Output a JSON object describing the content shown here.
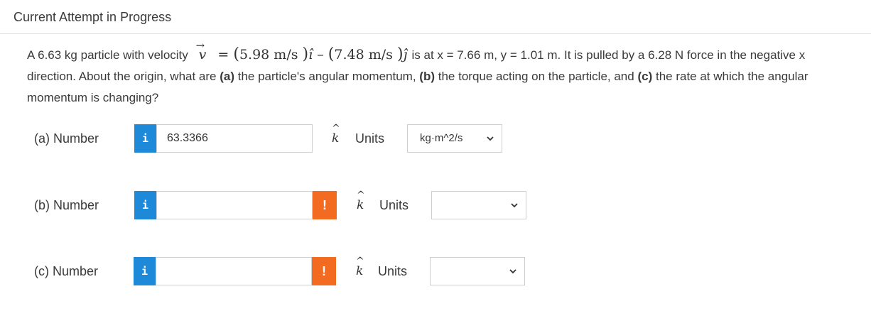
{
  "header": {
    "title": "Current Attempt in Progress"
  },
  "question": {
    "intro": "A 6.63 kg particle with velocity",
    "vector_symbol": "v",
    "equals": "=",
    "vx_value": "5.98 m/s",
    "i_hat": "î",
    "minus": "–",
    "vy_value": "7.48 m/s",
    "j_hat": "ĵ",
    "middle": "is at x = 7.66 m, y = 1.01 m. It is pulled by a 6.28 N force in the negative x direction. About the origin, what are",
    "part_a_tag": "(a)",
    "part_a_text": "the particle's angular momentum,",
    "part_b_tag": "(b)",
    "part_b_text": "the torque acting on the particle, and",
    "part_c_tag": "(c)",
    "part_c_text": "the rate at which the angular momentum is changing?"
  },
  "answers": [
    {
      "label": "(a)   Number",
      "info": "i",
      "value": "63.3366",
      "warn": "",
      "unit_vector": "k",
      "units_label": "Units",
      "units_selected": "kg·m^2/s"
    },
    {
      "label": "(b)   Number",
      "info": "i",
      "value": "",
      "warn": "!",
      "unit_vector": "k",
      "units_label": "Units",
      "units_selected": ""
    },
    {
      "label": "(c)   Number",
      "info": "i",
      "value": "",
      "warn": "!",
      "unit_vector": "k",
      "units_label": "Units",
      "units_selected": ""
    }
  ],
  "colors": {
    "info": "#1e88d9",
    "warning": "#f26b21"
  }
}
